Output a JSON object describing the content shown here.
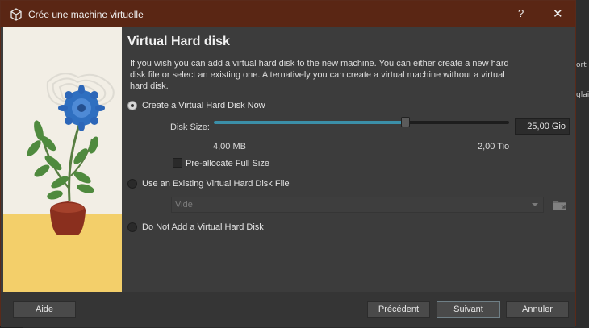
{
  "window": {
    "title": "Crée une machine virtuelle",
    "help_label": "?",
    "close_label": "✕"
  },
  "page": {
    "heading": "Virtual Hard disk",
    "description": "If you wish you can add a virtual hard disk to the new machine. You can either create a new hard disk file or select an existing one. Alternatively you can create a virtual machine without a virtual hard disk."
  },
  "options": {
    "create_now": {
      "label": "Create a Virtual Hard Disk Now",
      "checked": true
    },
    "use_existing": {
      "label": "Use an Existing Virtual Hard Disk File",
      "checked": false
    },
    "no_disk": {
      "label": "Do Not Add a Virtual Hard Disk",
      "checked": false
    }
  },
  "disk_size": {
    "label": "Disk Size:",
    "value": "25,00 Gio",
    "min_label": "4,00 MB",
    "max_label": "2,00 Tio",
    "slider_fraction": 0.65
  },
  "preallocate": {
    "label": "Pre-allocate Full Size",
    "checked": false
  },
  "existing_file": {
    "selected": "Vide"
  },
  "buttons": {
    "help": "Aide",
    "previous": "Précédent",
    "next": "Suivant",
    "cancel": "Annuler"
  },
  "background_fragments": [
    "ort",
    "glais"
  ],
  "colors": {
    "titlebar": "#5a2614",
    "accent": "#3b8fa8",
    "dialog_bg": "#3c3c3c"
  }
}
